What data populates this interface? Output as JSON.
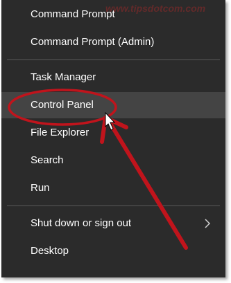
{
  "watermark": "www.tipsdotcom.com",
  "menu": {
    "items": [
      {
        "label": "Command Prompt"
      },
      {
        "label": "Command Prompt (Admin)"
      },
      {
        "label": "Task Manager"
      },
      {
        "label": "Control Panel"
      },
      {
        "label": "File Explorer"
      },
      {
        "label": "Search"
      },
      {
        "label": "Run"
      },
      {
        "label": "Shut down or sign out"
      },
      {
        "label": "Desktop"
      }
    ]
  },
  "colors": {
    "menu_background": "#2b2b2b",
    "highlight": "#444444",
    "annotation": "#c0141c"
  },
  "icons": {
    "submenu": "chevron-right-icon",
    "cursor": "mouse-pointer-icon"
  }
}
